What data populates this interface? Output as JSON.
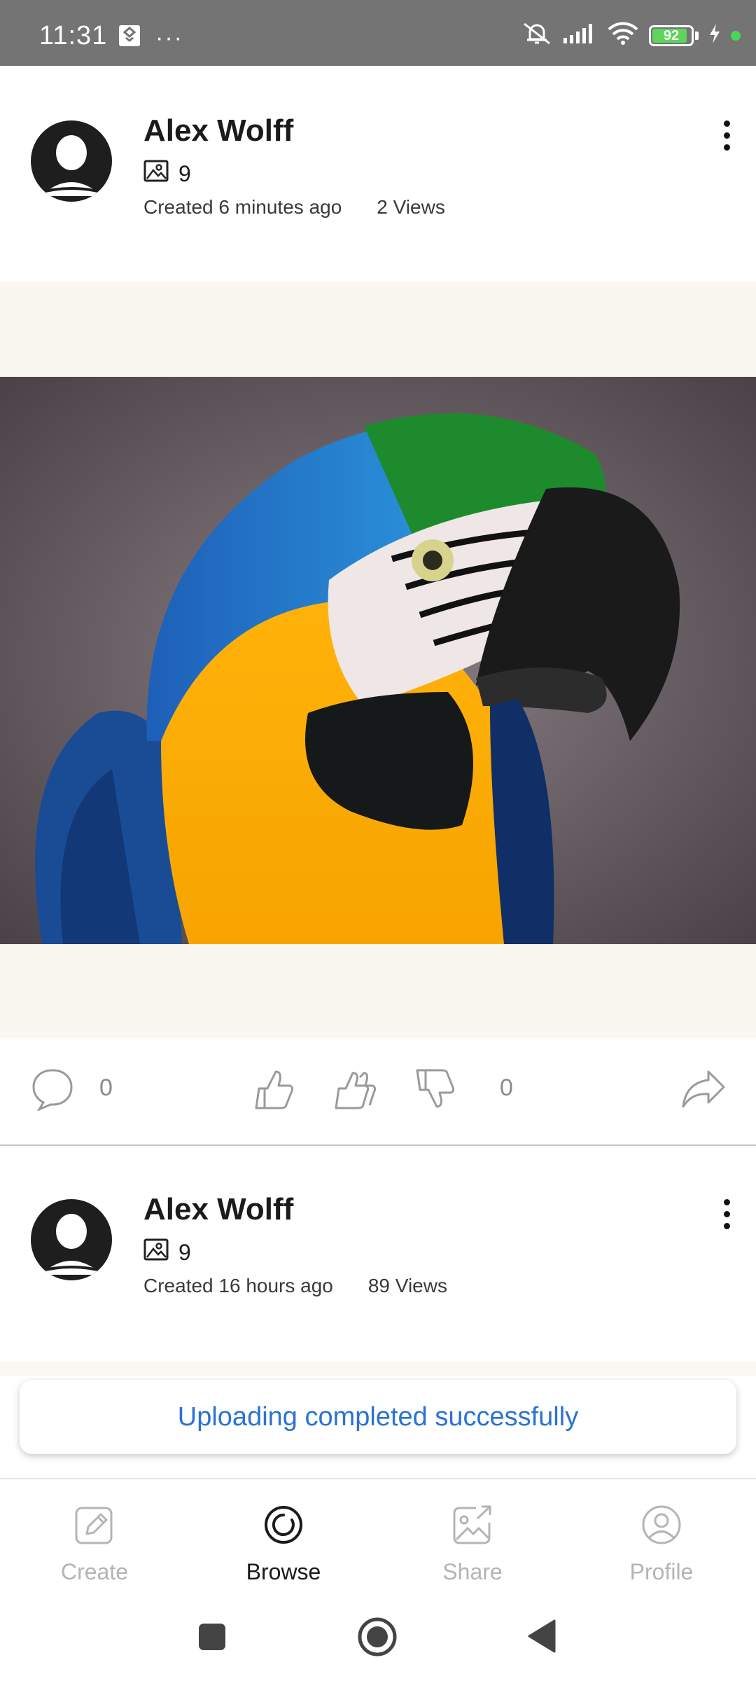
{
  "status_bar": {
    "time": "11:31",
    "battery_level": "92",
    "battery_percent": 92
  },
  "posts": [
    {
      "author": "Alex Wolff",
      "image_count": "9",
      "created": "Created 6 minutes ago",
      "views": "2 Views",
      "comments_count": "0",
      "reactions_count": "0"
    },
    {
      "author": "Alex Wolff",
      "image_count": "9",
      "created": "Created 16 hours ago",
      "views": "89 Views"
    }
  ],
  "toast": {
    "message": "Uploading completed successfully"
  },
  "bottom_nav": {
    "items": [
      {
        "label": "Create",
        "icon": "pencil-square-icon",
        "active": false
      },
      {
        "label": "Browse",
        "icon": "browse-circle-icon",
        "active": true
      },
      {
        "label": "Share",
        "icon": "share-image-icon",
        "active": false
      },
      {
        "label": "Profile",
        "icon": "profile-icon",
        "active": false
      }
    ]
  },
  "colors": {
    "status_bar": "#747474",
    "media_background": "#f9f7f0",
    "toast_text": "#2a73d1",
    "inactive_nav": "#b4b4b4",
    "battery_fill": "#5dd55d"
  }
}
